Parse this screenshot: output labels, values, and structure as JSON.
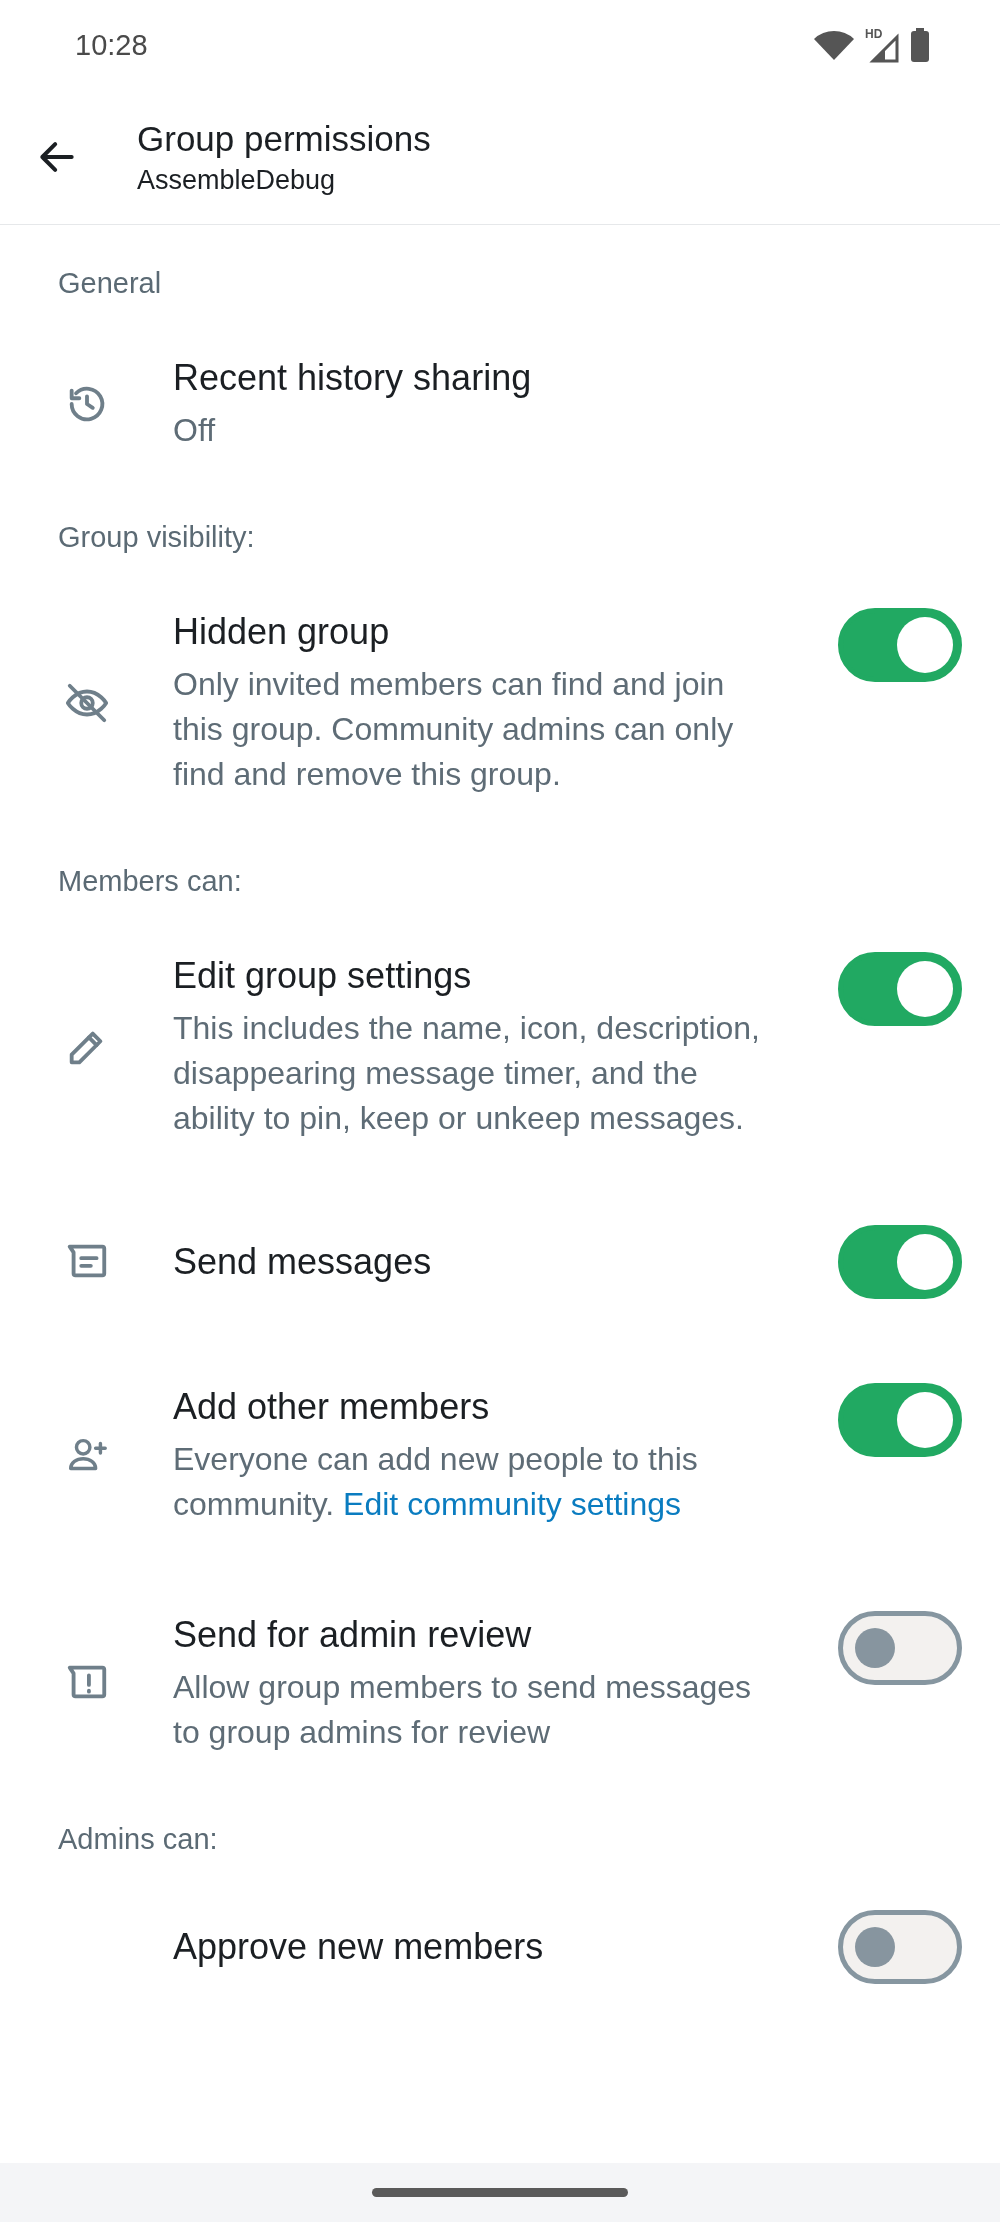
{
  "status_bar": {
    "time": "10:28",
    "network_label": "HD"
  },
  "app_bar": {
    "title": "Group permissions",
    "subtitle": "AssembleDebug"
  },
  "sections": [
    {
      "header": "General",
      "items": [
        {
          "kind": "value",
          "title": "Recent history sharing",
          "value": "Off"
        }
      ]
    },
    {
      "header": "Group visibility:",
      "items": [
        {
          "kind": "toggle",
          "title": "Hidden group",
          "description": "Only invited members can find and join this group. Community admins can only find and remove this group.",
          "on": true
        }
      ]
    },
    {
      "header": "Members can:",
      "items": [
        {
          "kind": "toggle",
          "title": "Edit group settings",
          "description": "This includes the name, icon, description, disappearing message timer, and the ability to pin, keep or unkeep messages.",
          "on": true
        },
        {
          "kind": "toggle",
          "title": "Send messages",
          "on": true
        },
        {
          "kind": "toggle",
          "title": "Add other members",
          "description": "Everyone can add new people to this community.",
          "link": "Edit community settings",
          "on": true
        },
        {
          "kind": "toggle",
          "title": "Send for admin review",
          "description": "Allow group members to send messages to group admins for review",
          "on": false
        }
      ]
    },
    {
      "header": "Admins can:",
      "items": [
        {
          "kind": "toggle",
          "title": "Approve new members",
          "on": false
        }
      ]
    }
  ]
}
